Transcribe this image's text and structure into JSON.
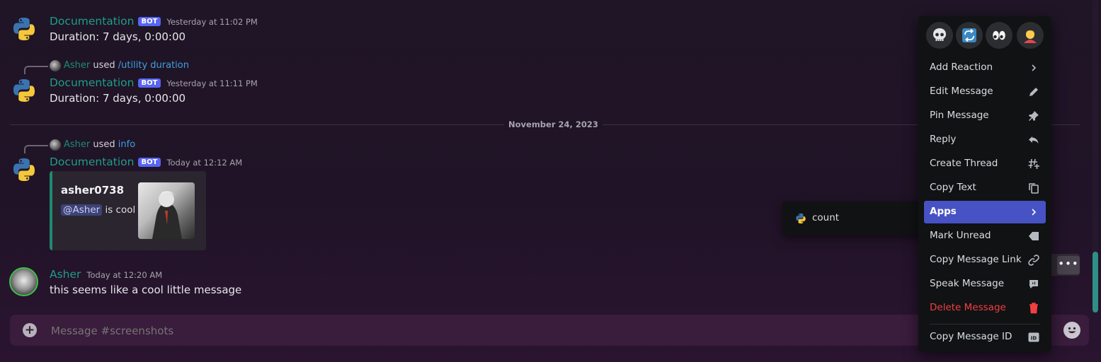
{
  "messages": [
    {
      "author": "Documentation",
      "bot_tag": "BOT",
      "timestamp": "Yesterday at 11:02 PM",
      "text": "Duration: 7 days, 0:00:00"
    },
    {
      "reply": {
        "name": "Asher",
        "verb": "used",
        "command": "/utility duration"
      },
      "author": "Documentation",
      "bot_tag": "BOT",
      "timestamp": "Yesterday at 11:11 PM",
      "text": "Duration: 7 days, 0:00:00"
    },
    {
      "reply": {
        "name": "Asher",
        "verb": "used",
        "command": "info"
      },
      "author": "Documentation",
      "bot_tag": "BOT",
      "timestamp": "Today at 12:12 AM",
      "embed": {
        "title": "asher0738",
        "mention": "@Asher",
        "desc": "is cool"
      }
    },
    {
      "author": "Asher",
      "timestamp": "Today at 12:20 AM",
      "text": "this seems like a cool little message"
    }
  ],
  "date_divider": "November 24, 2023",
  "composer": {
    "placeholder": "Message #screenshots"
  },
  "apps_submenu": {
    "items": [
      {
        "label": "count",
        "icon": "python-icon"
      }
    ]
  },
  "context_menu": {
    "reactions": [
      "skull-emoji",
      "repeat-emoji",
      "eyes-emoji",
      "person-emoji"
    ],
    "items": [
      {
        "label": "Add Reaction",
        "icon": "chevron-right-icon"
      },
      {
        "label": "Edit Message",
        "icon": "pencil-icon"
      },
      {
        "label": "Pin Message",
        "icon": "pin-icon"
      },
      {
        "label": "Reply",
        "icon": "reply-icon"
      },
      {
        "label": "Create Thread",
        "icon": "thread-icon"
      },
      {
        "label": "Copy Text",
        "icon": "copy-icon"
      },
      {
        "label": "Apps",
        "icon": "chevron-right-icon",
        "active": true
      },
      {
        "label": "Mark Unread",
        "icon": "mark-unread-icon"
      },
      {
        "label": "Copy Message Link",
        "icon": "link-icon"
      },
      {
        "label": "Speak Message",
        "icon": "speak-icon"
      },
      {
        "label": "Delete Message",
        "icon": "trash-icon",
        "danger": true
      },
      {
        "label": "Copy Message ID",
        "icon": "id-icon"
      }
    ]
  },
  "colors": {
    "accent": "#4752c4",
    "bot_tag": "#5865f2",
    "danger": "#f23f42",
    "username": "#1e9e84"
  }
}
